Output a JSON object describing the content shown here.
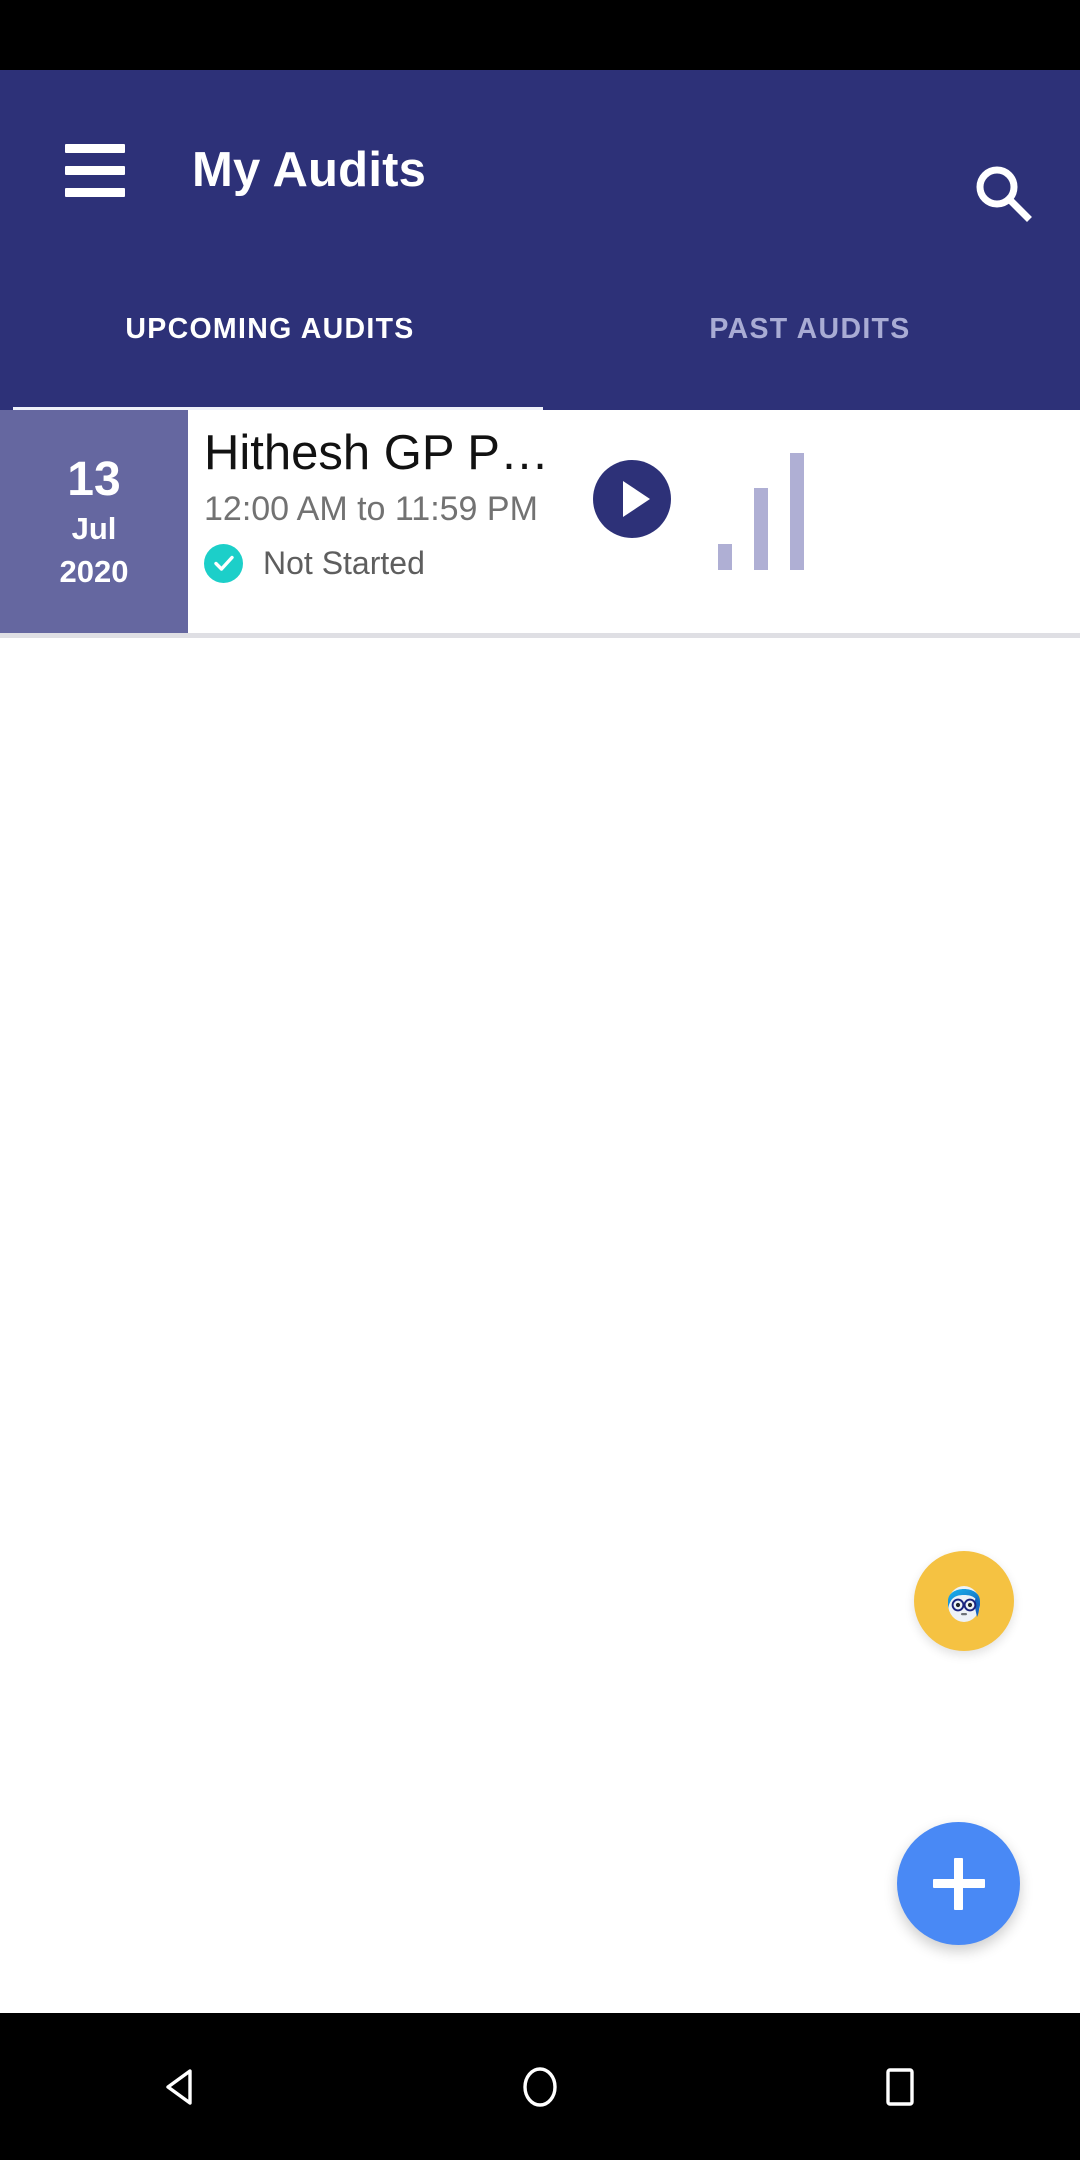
{
  "theme": {
    "appbar_bg": "#2D3178",
    "date_block_bg": "#6567A0",
    "accent_teal": "#1CCFC9",
    "fab_add_bg": "#4989F5",
    "fab_avatar_bg": "#F5C242",
    "bars_color": "#AFAFD4",
    "body_bg": "#FFFFFF",
    "navbar_bg": "#000000"
  },
  "appbar": {
    "title": "My Audits",
    "menu_icon": "hamburger-menu-icon",
    "search_icon": "search-icon"
  },
  "tabs": [
    {
      "label": "UPCOMING AUDITS",
      "active": true
    },
    {
      "label": "PAST AUDITS",
      "active": false
    }
  ],
  "audits": [
    {
      "day": "13",
      "month": "Jul",
      "year": "2020",
      "title": "Hithesh GP P…",
      "time": "12:00 AM to 11:59 PM",
      "status": "Not Started",
      "status_icon": "check-circle-icon",
      "play_icon": "play-icon",
      "chart_icon": "signal-bars-icon"
    }
  ],
  "fabs": {
    "avatar": {
      "icon": "avatar-icon",
      "label": ""
    },
    "add": {
      "icon": "plus-icon",
      "label": ""
    }
  },
  "navbar": {
    "back": "back-triangle-icon",
    "home": "home-circle-icon",
    "recents": "recents-square-icon"
  }
}
